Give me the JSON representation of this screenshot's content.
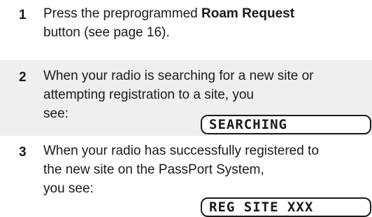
{
  "steps": [
    {
      "number": "1",
      "line1_prefix": "Press the preprogrammed ",
      "line1_bold": "Roam Request",
      "line2": "button (see page 16)."
    },
    {
      "number": "2",
      "line1": "When your radio is searching for a new site or",
      "line2": "attempting registration to a site, you",
      "line3": "see:",
      "display": "SEARCHING"
    },
    {
      "number": "3",
      "line1": "When your radio has successfully registered to",
      "line2": "the new site on the PassPort System,",
      "line3": "you see:",
      "display": "REG SITE XXX"
    }
  ]
}
